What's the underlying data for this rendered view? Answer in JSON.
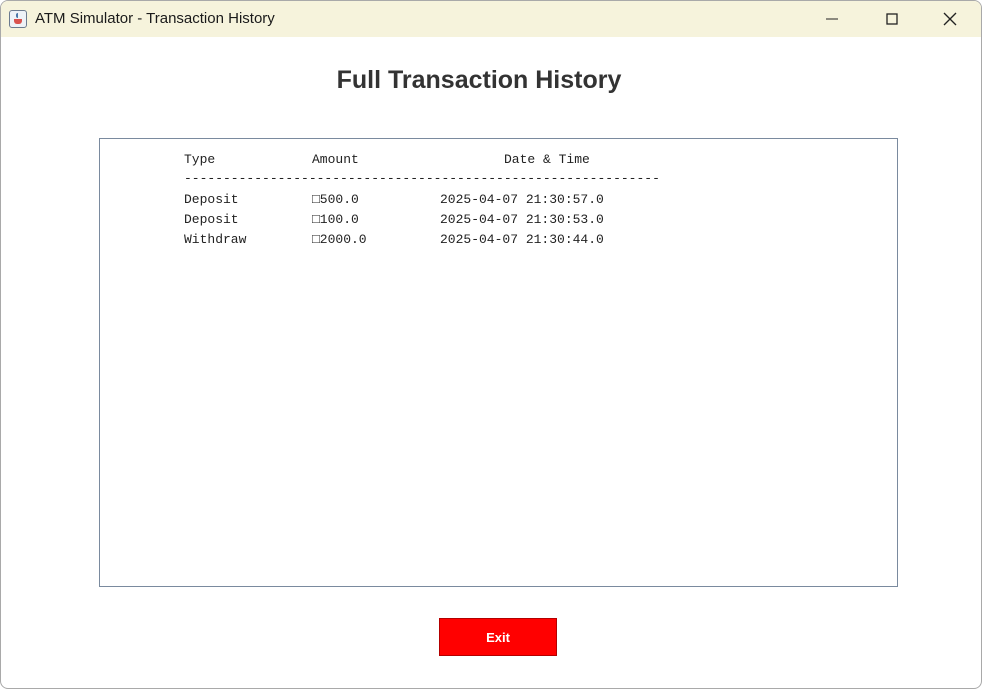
{
  "window": {
    "title": "ATM Simulator - Transaction History",
    "icon": "java-app-icon",
    "controls": [
      "minimize-icon",
      "maximize-icon",
      "close-icon"
    ]
  },
  "page": {
    "heading": "Full Transaction History"
  },
  "history": {
    "headers": {
      "type": "Type",
      "amount": "Amount",
      "datetime": "Date & Time"
    },
    "separator": "-------------------------------------------------------------",
    "rows": [
      {
        "type": "Deposit",
        "amount": "□500.0",
        "datetime": "2025-04-07 21:30:57.0"
      },
      {
        "type": "Deposit",
        "amount": "□100.0",
        "datetime": "2025-04-07 21:30:53.0"
      },
      {
        "type": "Withdraw",
        "amount": "□2000.0",
        "datetime": "2025-04-07 21:30:44.0"
      }
    ]
  },
  "actions": {
    "exit_label": "Exit"
  },
  "colors": {
    "titlebar": "#f6f3dc",
    "exit_button": "#ff0000",
    "heading": "#333333"
  }
}
